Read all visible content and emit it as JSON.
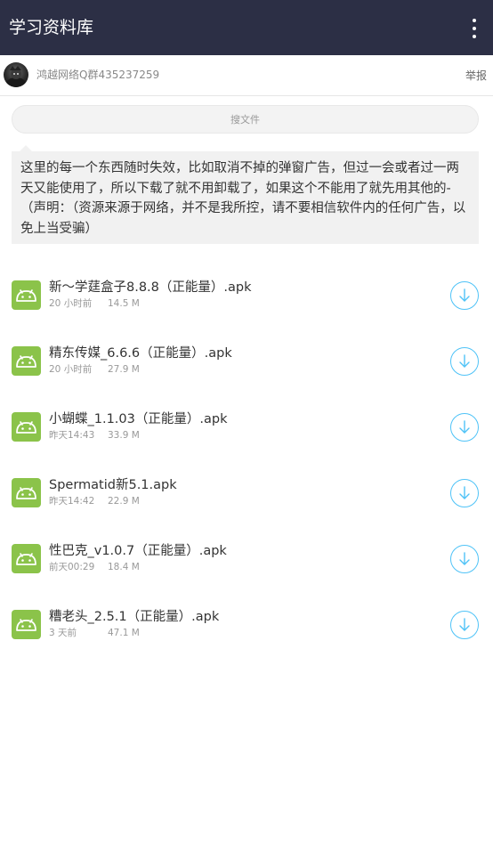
{
  "header": {
    "title": "学习资料库",
    "menu_icon": "more-vertical-icon"
  },
  "owner": {
    "name": "鸿越网络Q群435237259",
    "report_label": "举报",
    "avatar_icon": "avatar-image"
  },
  "search": {
    "placeholder": "搜文件"
  },
  "notice": {
    "text": "这里的每一个东西随时失效，比如取消不掉的弹窗广告，但过一会或者过一两天又能使用了，所以下载了就不用卸载了，如果这个不能用了就先用其他的-（声明：（资源来源于网络，并不是我所控，请不要相信软件内的任何广告，以免上当受骗）"
  },
  "files": [
    {
      "name": "新～学莛盒子8.8.8（正能量）.apk",
      "time": "20 小时前",
      "size": "14.5 M"
    },
    {
      "name": "精东传媒_6.6.6（正能量）.apk",
      "time": "20 小时前",
      "size": "27.9 M"
    },
    {
      "name": "小蝴蝶_1.1.03（正能量）.apk",
      "time": "昨天14:43",
      "size": "33.9 M"
    },
    {
      "name": "Spermatid新5.1.apk",
      "time": "昨天14:42",
      "size": "22.9 M"
    },
    {
      "name": "性巴克_v1.0.7（正能量）.apk",
      "time": "前天00:29",
      "size": "18.4 M"
    },
    {
      "name": "糟老头_2.5.1（正能量）.apk",
      "time": "3 天前",
      "size": "47.1 M"
    }
  ],
  "colors": {
    "appbar": "#2c2f45",
    "apk_icon": "#8bc34a",
    "download_accent": "#4fc3f7"
  },
  "icons": {
    "file_icon": "android-icon",
    "download_icon": "download-circle-icon"
  }
}
